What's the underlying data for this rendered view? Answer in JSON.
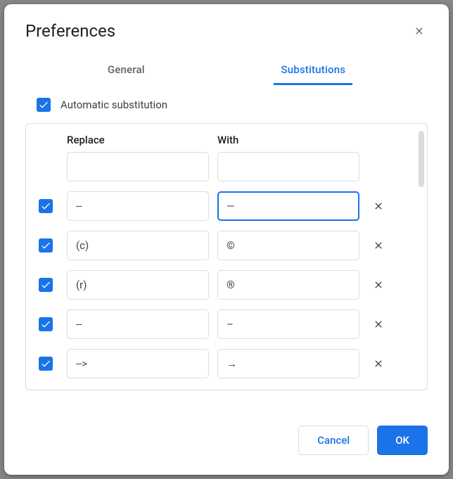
{
  "dialog": {
    "title": "Preferences"
  },
  "tabs": {
    "general": "General",
    "substitutions": "Substitutions",
    "active": "substitutions"
  },
  "autosub": {
    "checked": true,
    "label": "Automatic substitution"
  },
  "columns": {
    "replace": "Replace",
    "with": "With"
  },
  "rows": [
    {
      "checked": null,
      "replace": "",
      "with": "",
      "deletable": false,
      "with_focused": false
    },
    {
      "checked": true,
      "replace": "--",
      "with": "—",
      "deletable": true,
      "with_focused": true
    },
    {
      "checked": true,
      "replace": "(c)",
      "with": "©",
      "deletable": true,
      "with_focused": false
    },
    {
      "checked": true,
      "replace": "(r)",
      "with": "®",
      "deletable": true,
      "with_focused": false
    },
    {
      "checked": true,
      "replace": "--",
      "with": "–",
      "deletable": true,
      "with_focused": false
    },
    {
      "checked": true,
      "replace": "-->",
      "with": "→",
      "deletable": true,
      "with_focused": false
    }
  ],
  "footer": {
    "cancel": "Cancel",
    "ok": "OK"
  }
}
